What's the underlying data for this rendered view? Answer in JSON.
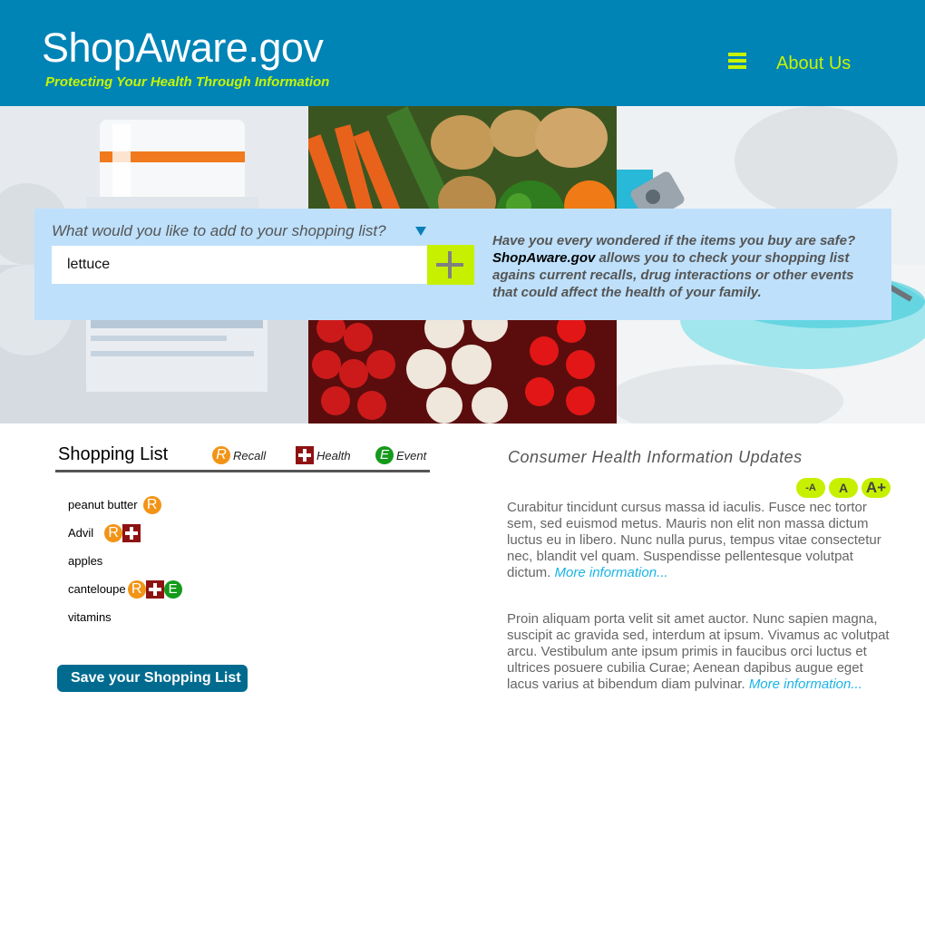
{
  "header": {
    "logo_title": "ShopAware.gov",
    "tagline": "Protecting Your Health Through Information",
    "menu_icon": "hamburger-icon",
    "about_label": "About Us",
    "bg_color": "#0083b5",
    "accent_color": "#c6f500"
  },
  "search": {
    "prompt": "What would you like to add to your shopping list?",
    "input_value": "lettuce",
    "add_icon": "plus-icon",
    "description_brand": "ShopAware.gov",
    "description_before": "Have you every wondered if the items you buy are safe?",
    "description_after": "allows you to check your shopping list agains current recalls, drug interactions or other events that could affect the health of your family."
  },
  "shopping_list": {
    "title": "Shopping List",
    "legend": [
      {
        "badge": "R",
        "label": "Recall",
        "icon": "recall-icon",
        "color": "#f29416"
      },
      {
        "badge": "+",
        "label": "Health",
        "icon": "health-cross-icon",
        "color": "#8f1212"
      },
      {
        "badge": "E",
        "label": "Event",
        "icon": "event-icon",
        "color": "#159a1c"
      }
    ],
    "items": [
      {
        "name": "peanut butter",
        "flags": [
          "R"
        ]
      },
      {
        "name": "Advil",
        "flags": [
          "R",
          "H"
        ]
      },
      {
        "name": "apples",
        "flags": []
      },
      {
        "name": "canteloupe",
        "flags": [
          "R",
          "H",
          "E"
        ]
      },
      {
        "name": "vitamins",
        "flags": []
      }
    ],
    "save_label": "Save your Shopping List"
  },
  "updates": {
    "title": "Consumer Health Information Updates",
    "font_sizes": [
      "-A",
      "A",
      "A+"
    ],
    "articles": [
      {
        "text": "Curabitur tincidunt cursus massa id iaculis. Fusce nec tortor sem, sed euismod metus. Mauris non elit non massa dictum luctus eu in libero. Nunc nulla purus, tempus vitae consectetur nec, blandit vel quam. Suspendisse pellentesque volutpat dictum.",
        "more": "More information..."
      },
      {
        "text": "Proin aliquam porta velit sit amet auctor. Nunc sapien magna, suscipit ac gravida sed, interdum at ipsum. Vivamus ac volutpat arcu. Vestibulum ante ipsum primis in faucibus orci luctus et ultrices posuere cubilia Curae; Aenean dapibus augue eget lacus varius at bibendum diam pulvinar.",
        "more": "More information..."
      }
    ]
  }
}
